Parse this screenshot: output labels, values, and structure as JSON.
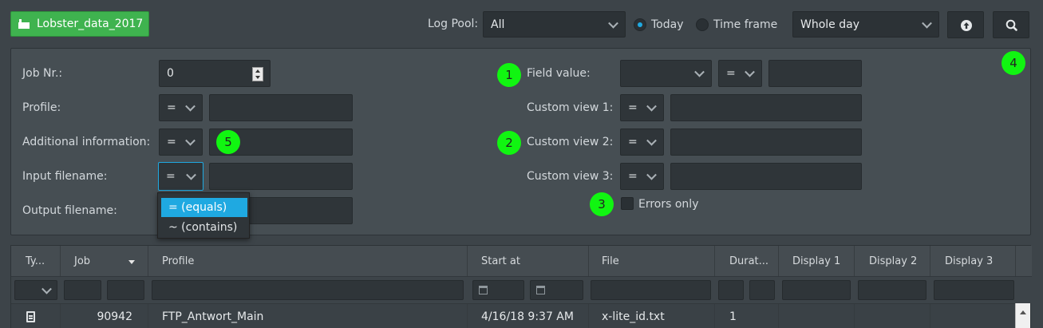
{
  "topbar": {
    "profile_button": "Lobster_data_2017",
    "logpool_label": "Log Pool:",
    "logpool_value": "All",
    "radio_today": "Today",
    "radio_timeframe": "Time frame",
    "range_value": "Whole day",
    "upload_icon": "circle-arrow-up-icon",
    "search_icon": "search-icon"
  },
  "filters": {
    "job_nr_label": "Job Nr.:",
    "job_nr_value": "0",
    "profile_label": "Profile:",
    "profile_op": "=",
    "additional_label": "Additional information:",
    "additional_op": "=",
    "input_filename_label": "Input filename:",
    "input_filename_op": "=",
    "output_filename_label": "Output filename:",
    "field_value_label": "Field value:",
    "field_value_op": "=",
    "custom1_label": "Custom view 1:",
    "custom1_op": "=",
    "custom2_label": "Custom view 2:",
    "custom2_op": "=",
    "custom3_label": "Custom view 3:",
    "custom3_op": "=",
    "errors_only_label": "Errors only"
  },
  "markers": [
    "1",
    "2",
    "3",
    "4",
    "5"
  ],
  "dropdown": {
    "options": [
      "= (equals)",
      "~ (contains)"
    ],
    "selected_index": 0
  },
  "grid": {
    "columns": [
      "Ty...",
      "Job",
      "Profile",
      "Start at",
      "File",
      "Durat...",
      "Display 1",
      "Display 2",
      "Display 3"
    ],
    "sorted_column": "Job",
    "rows": [
      {
        "type_icon": "document-icon",
        "job": "90942",
        "profile": "FTP_Antwort_Main",
        "start_at": "4/16/18 9:37 AM",
        "file": "x-lite_id.txt",
        "duration": "1",
        "display1": "",
        "display2": "",
        "display3": ""
      }
    ]
  },
  "colors": {
    "accent": "#1fa9e1",
    "green_button": "#3fb34f",
    "marker": "#11f511"
  }
}
